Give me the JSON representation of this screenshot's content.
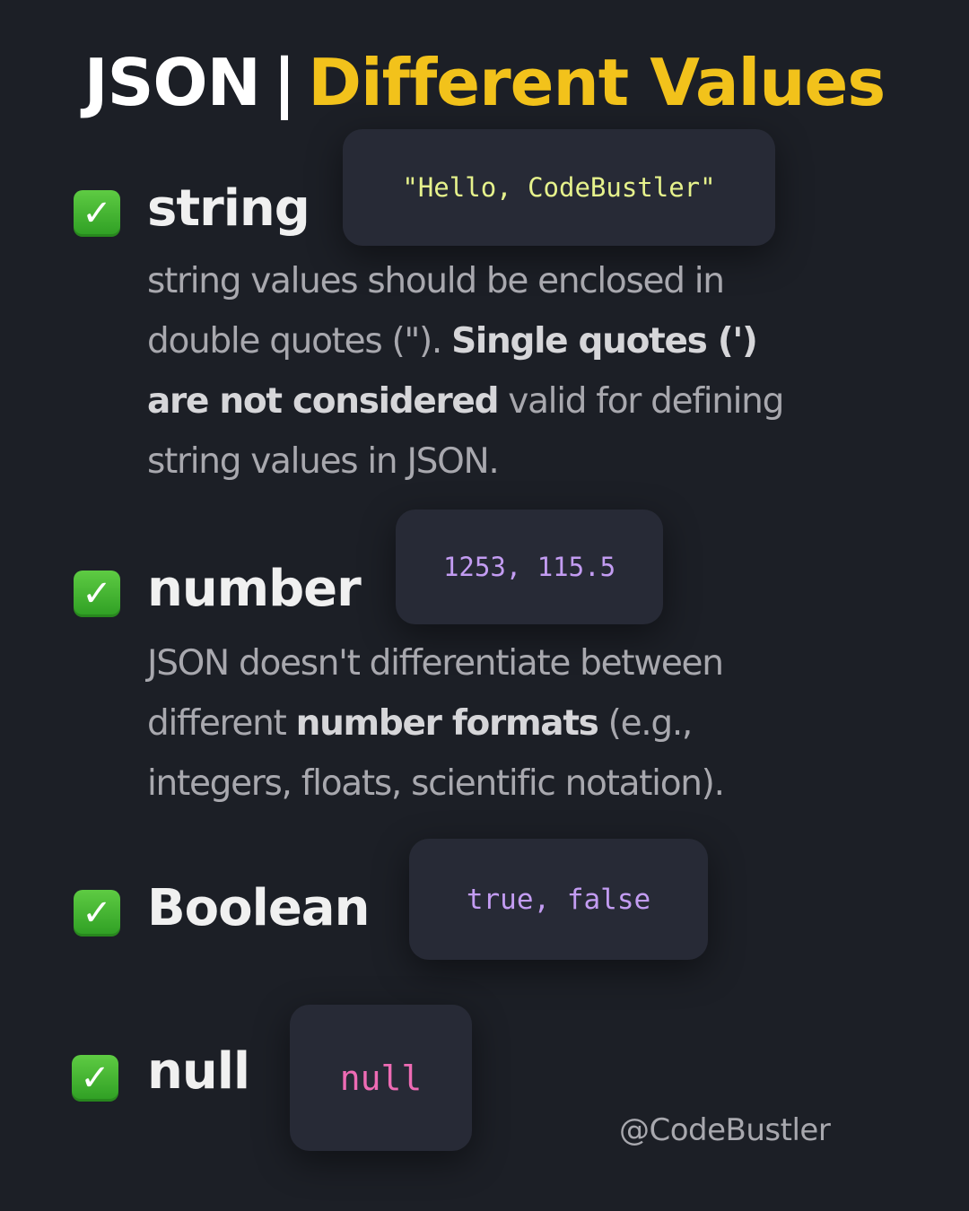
{
  "title": {
    "part1": "JSON",
    "separator": "|",
    "part2": "Different Values"
  },
  "colors": {
    "background": "#1c1f26",
    "title_accent": "#f2c21b",
    "check_green": "#3fb62f",
    "string_code": "#e6f28c",
    "number_code": "#c39cf2",
    "boolean_code": "#c39cf2",
    "null_code": "#ee6bb4"
  },
  "sections": [
    {
      "icon": "check-mark-button-icon",
      "heading": "string",
      "example": "\"Hello, CodeBustler\"",
      "lines": [
        [
          {
            "text": "string values should be enclosed in"
          }
        ],
        [
          {
            "text": "double quotes (\"). "
          },
          {
            "text": "Single quotes (')",
            "bold": true
          }
        ],
        [
          {
            "text": "are not considered",
            "bold": true
          },
          {
            "text": " valid for defining"
          }
        ],
        [
          {
            "text": "string values in JSON."
          }
        ]
      ]
    },
    {
      "icon": "check-mark-button-icon",
      "heading": "number",
      "example": "1253, 115.5",
      "lines": [
        [
          {
            "text": "JSON doesn't differentiate between"
          }
        ],
        [
          {
            "text": "different "
          },
          {
            "text": "number formats",
            "bold": true
          },
          {
            "text": " (e.g.,"
          }
        ],
        [
          {
            "text": "integers, floats, scientific notation)."
          }
        ]
      ]
    },
    {
      "icon": "check-mark-button-icon",
      "heading": "Boolean",
      "example": "true, false"
    },
    {
      "icon": "check-mark-button-icon",
      "heading": "null",
      "example": "null"
    }
  ],
  "handle": "@CodeBustler"
}
